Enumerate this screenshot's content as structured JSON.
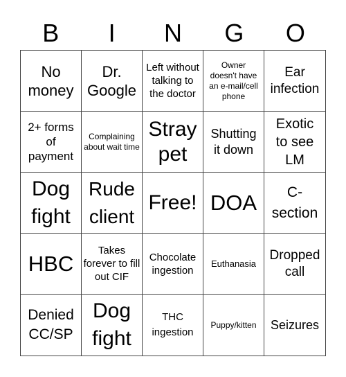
{
  "header": {
    "letters": [
      "B",
      "I",
      "N",
      "G",
      "O"
    ]
  },
  "cells": [
    "No money",
    "Dr. Google",
    "Left without talking to the doctor",
    "Owner doesn't have an e-mail/cell phone",
    "Ear infection",
    "2+ forms of payment",
    "Complaining about wait time",
    "Stray pet",
    "Shutting it down",
    "Exotic to see LM",
    "Dog fight",
    "Rude client",
    "Free!",
    "DOA",
    "C-section",
    "HBC",
    "Takes forever to fill out CIF",
    "Chocolate ingestion",
    "Euthanasia",
    "Dropped call",
    "Denied CC/SP",
    "Dog fight",
    "THC ingestion",
    "Puppy/kitten",
    "Seizures"
  ]
}
